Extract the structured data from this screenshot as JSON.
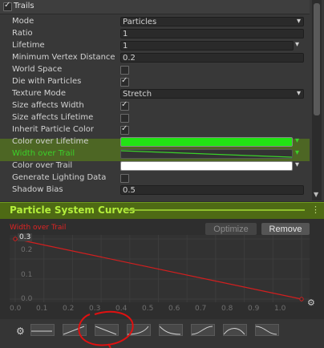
{
  "module": {
    "title": "Trails",
    "enabled": true
  },
  "properties": {
    "mode": {
      "label": "Mode",
      "value": "Particles"
    },
    "ratio": {
      "label": "Ratio",
      "value": "1"
    },
    "lifetime": {
      "label": "Lifetime",
      "value": "1"
    },
    "min_vertex_distance": {
      "label": "Minimum Vertex Distance",
      "value": "0.2"
    },
    "world_space": {
      "label": "World Space",
      "checked": false
    },
    "die_with_particles": {
      "label": "Die with Particles",
      "checked": true
    },
    "texture_mode": {
      "label": "Texture Mode",
      "value": "Stretch"
    },
    "size_affects_width": {
      "label": "Size affects Width",
      "checked": true
    },
    "size_affects_lifetime": {
      "label": "Size affects Lifetime",
      "checked": false
    },
    "inherit_particle_color": {
      "label": "Inherit Particle Color",
      "checked": true
    },
    "color_over_lifetime": {
      "label": "Color over Lifetime",
      "color": "#22e314"
    },
    "width_over_trail": {
      "label": "Width over Trail"
    },
    "color_over_trail": {
      "label": "Color over Trail",
      "color": "#ffffff"
    },
    "generate_lighting_data": {
      "label": "Generate Lighting Data",
      "checked": false
    },
    "shadow_bias": {
      "label": "Shadow Bias",
      "value": "0.5"
    }
  },
  "curves": {
    "title": "Particle System Curves",
    "curve_name": "Width over Trail",
    "optimize_label": "Optimize",
    "remove_label": "Remove",
    "y_ticks": [
      "0.3",
      "0.2",
      "0.1",
      "0.0"
    ],
    "x_ticks": [
      "0.0",
      "0.1",
      "0.2",
      "0.3",
      "0.4",
      "0.5",
      "0.6",
      "0.7",
      "0.8",
      "0.9",
      "1.0"
    ],
    "curve_points": [
      [
        0.0,
        0.3
      ],
      [
        1.0,
        0.0
      ]
    ],
    "y_range": [
      0.0,
      0.3
    ],
    "x_range": [
      0.0,
      1.0
    ],
    "curve_color": "#d21f1f",
    "presets": [
      "flat",
      "linear-up",
      "linear-down",
      "ease-in",
      "ease-out",
      "ease-in-out-up",
      "bell",
      "ease-in-out-down"
    ]
  },
  "colors": {
    "highlight": "#5f8c14",
    "annotation": "#e01010"
  }
}
